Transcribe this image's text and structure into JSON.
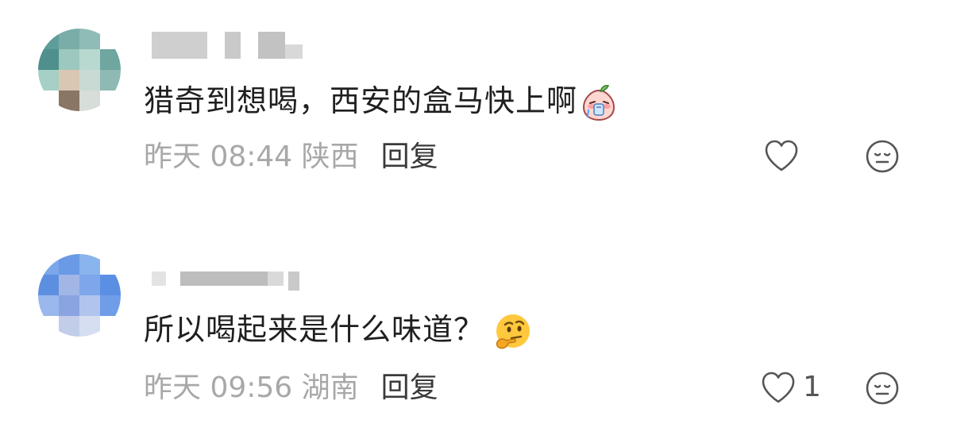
{
  "comments": [
    {
      "text": "猎奇到想喝，西安的盒马快上啊",
      "emoji": "crying-peach-sticker",
      "time_location": "昨天 08:44 陕西",
      "reply_label": "回复",
      "like_count": "",
      "avatar_colors": [
        "#5e9e9a",
        "#7aada8",
        "#8fbcb7",
        "#ffffff",
        "#4f8f8c",
        "#9cc8bf",
        "#b8d9d0",
        "#6fa6a0",
        "#a6cfc6",
        "#d9c7b3",
        "#c8dad3",
        "#8fb9b3",
        "#ffffff",
        "#8a7664",
        "#d7ddd8",
        "#ffffff"
      ],
      "username_color": "#cccccc"
    },
    {
      "text": "所以喝起来是什么味道？",
      "emoji": "thinking-face-emoji",
      "time_location": "昨天 09:56 湖南",
      "reply_label": "回复",
      "like_count": "1",
      "avatar_colors": [
        "#7aa8e8",
        "#6a9ae6",
        "#8ab4ee",
        "#ffffff",
        "#5d8fe0",
        "#a2b6e6",
        "#7ea6ea",
        "#5a8fe4",
        "#9ab8ee",
        "#8aa4e2",
        "#b0c4ee",
        "#6f9de8",
        "#ffffff",
        "#c2cdea",
        "#d6def2",
        "#ffffff"
      ],
      "username_color": "#cccccc"
    }
  ],
  "icons": {
    "like": "heart-outline-icon",
    "react": "neutral-face-icon"
  }
}
